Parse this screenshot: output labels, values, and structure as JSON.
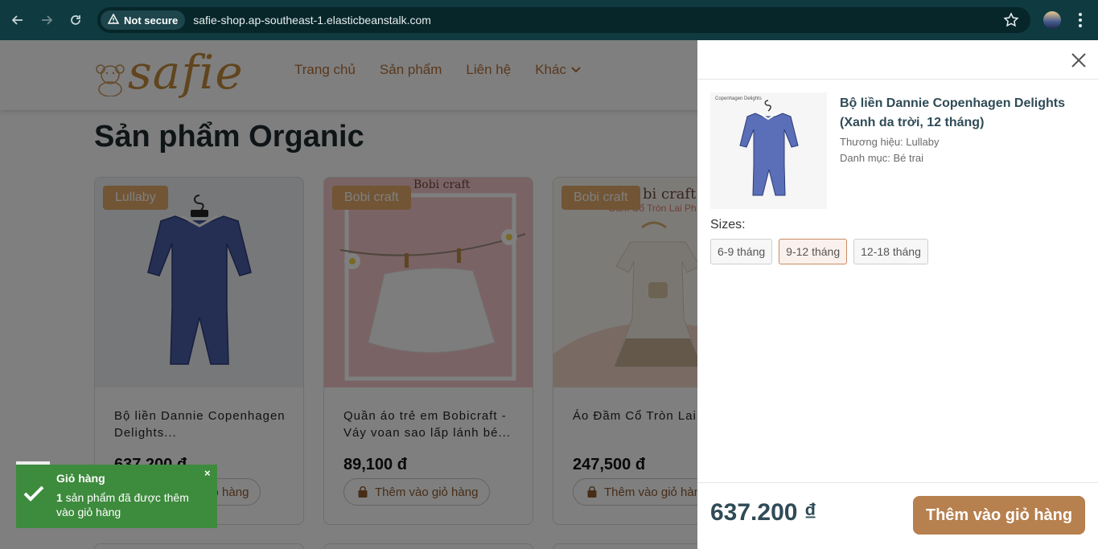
{
  "browser": {
    "security_label": "Not secure",
    "url": "safie-shop.ap-southeast-1.elasticbeanstalk.com",
    "icons": [
      "back-icon",
      "forward-icon",
      "reload-icon",
      "warning-icon",
      "star-icon",
      "avatar",
      "more-icon"
    ]
  },
  "site": {
    "logo_text": "safie",
    "menu": {
      "home": "Trang chủ",
      "products": "Sản phẩm",
      "contact": "Liên hệ",
      "more": "Khác"
    },
    "page_title": "Sản phẩm Organic"
  },
  "products": [
    {
      "badge": "Lullaby",
      "name": "Bộ liền Dannie Copenhagen Delights...",
      "price": "637,200 đ",
      "add_label": "Thêm vào giỏ hàng"
    },
    {
      "badge": "Bobi craft",
      "image_brand": "Bobi craft",
      "name": "Quần áo trẻ em Bobicraft - Váy voan sao lấp lánh bé...",
      "price": "89,100 đ",
      "add_label": "Thêm vào giỏ hàng"
    },
    {
      "badge": "Bobi craft",
      "image_brand": "bi craft",
      "image_caption": "Đầm Cổ Tròn Lai Ph",
      "name": "Áo Đầm Cổ Tròn Lai",
      "price": "247,500 đ",
      "add_label": "Thêm vào giỏ hàng"
    }
  ],
  "cart_panel": {
    "product_image_brand": "Copenhagen Delights",
    "product_name": "Bộ liền Dannie Copenhagen Delights (Xanh da trời, 12 tháng)",
    "brand": "Thương hiệu: Lullaby",
    "category": "Danh mục: Bé trai",
    "sizes_label": "Sizes:",
    "sizes": [
      "6-9 tháng",
      "9-12 tháng",
      "12-18 tháng"
    ],
    "selected_size": "9-12 tháng",
    "total": "637.200 ₫",
    "checkout_label": "Thêm vào giỏ hàng"
  },
  "toast": {
    "title": "Giỏ hàng",
    "count": "1",
    "message": " sản phẩm đã được thêm vào giỏ hàng",
    "close": "×"
  },
  "colors": {
    "chrome_bg": "#0f3a40",
    "brand_brown": "#b7804f",
    "badge": "#e3ab6b",
    "toast_green": "#3d8b3d",
    "title_text": "#2f4b57"
  }
}
